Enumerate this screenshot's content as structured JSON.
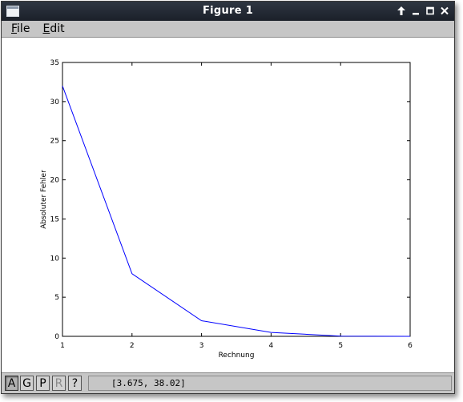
{
  "window": {
    "title": "Figure 1",
    "controls": [
      "up-arrow-icon",
      "minimize-icon",
      "maximize-icon",
      "close-icon"
    ]
  },
  "menu": {
    "items": [
      {
        "label_u": "F",
        "label_rest": "ile"
      },
      {
        "label_u": "E",
        "label_rest": "dit"
      }
    ]
  },
  "toolbar": {
    "buttons": [
      {
        "label": "A",
        "state": "pressed"
      },
      {
        "label": "G",
        "state": "normal"
      },
      {
        "label": "P",
        "state": "normal"
      },
      {
        "label": "R",
        "state": "disabled"
      },
      {
        "label": "?",
        "state": "normal"
      }
    ],
    "coordinates": "[3.675, 38.02]"
  },
  "chart_data": {
    "type": "line",
    "title": "",
    "xlabel": "Rechnung",
    "ylabel": "Absoluter Fehler",
    "xlim": [
      1,
      6
    ],
    "ylim": [
      0,
      35
    ],
    "x_ticks": [
      "1",
      "2",
      "3",
      "4",
      "5",
      "6"
    ],
    "y_ticks": [
      "0",
      "5",
      "10",
      "15",
      "20",
      "25",
      "30",
      "35"
    ],
    "grid": false,
    "series": [
      {
        "x": [
          1,
          2,
          3,
          4,
          5,
          6
        ],
        "values": [
          32,
          8,
          2,
          0.5,
          0.03,
          0
        ],
        "color": "#0000ff"
      }
    ]
  }
}
